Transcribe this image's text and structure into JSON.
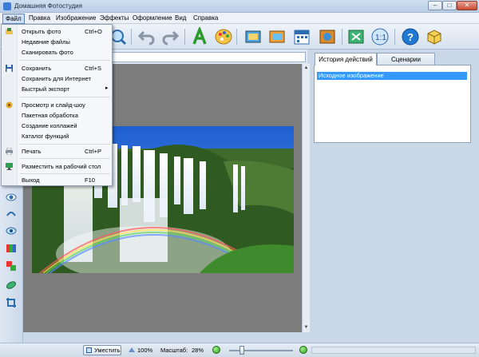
{
  "window": {
    "title": "Домашняя Фотостудия",
    "min": "–",
    "max": "□",
    "close": "✕"
  },
  "menubar": [
    "Файл",
    "Правка",
    "Изображение",
    "Эффекты",
    "Оформление",
    "Вид",
    "Справка"
  ],
  "file_menu": [
    {
      "label": "Открыть фото",
      "shortcut": "Ctrl+O",
      "icon": "open-folder-icon"
    },
    {
      "label": "Недавние файлы",
      "shortcut": ""
    },
    {
      "label": "Сканировать фото",
      "shortcut": ""
    },
    {
      "label": "Сохранить",
      "shortcut": "Ctrl+S",
      "icon": "floppy-icon"
    },
    {
      "label": "Сохранить для Интернет",
      "shortcut": ""
    },
    {
      "label": "Быстрый экспорт",
      "shortcut": "",
      "submenu": "▸"
    },
    {
      "label": "Просмотр и слайд-шоу",
      "shortcut": "",
      "icon": "slideshow-icon"
    },
    {
      "label": "Пакетная обработка",
      "shortcut": ""
    },
    {
      "label": "Создание коллажей",
      "shortcut": ""
    },
    {
      "label": "Каталог функций",
      "shortcut": ""
    },
    {
      "label": "Печать",
      "shortcut": "Ctrl+P",
      "icon": "printer-icon"
    },
    {
      "label": "Разместить на рабочий стол",
      "shortcut": "",
      "icon": "desktop-icon"
    },
    {
      "label": "Выход",
      "shortcut": "F10"
    }
  ],
  "history": {
    "tab_label": "История действий",
    "items": [
      "Исходное изображение"
    ]
  },
  "scenarios_tab": "Сценарии",
  "status": {
    "fit_label": "Уместить",
    "zoom_100": "100%",
    "scale_label": "Масштаб:",
    "scale_value": "28%",
    "zoom_minus": "−",
    "zoom_plus": "+"
  },
  "accent": "#3399ff"
}
